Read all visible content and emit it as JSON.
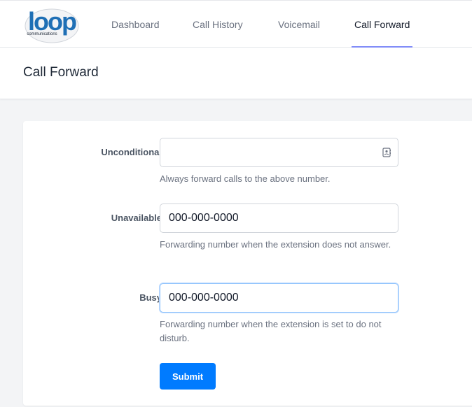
{
  "brand": {
    "logo_text": "loop",
    "logo_subtext": "communications",
    "logo_color": "#1f6fb5"
  },
  "nav": {
    "items": [
      {
        "label": "Dashboard"
      },
      {
        "label": "Call History"
      },
      {
        "label": "Voicemail"
      },
      {
        "label": "Call Forward",
        "active": true
      }
    ],
    "active_underline_color": "#818cf8"
  },
  "page": {
    "title": "Call Forward"
  },
  "form": {
    "unconditional": {
      "label": "Unconditional",
      "value": "",
      "help": "Always forward calls to the above number.",
      "icon": "contact-card-icon"
    },
    "unavailable": {
      "label": "Unavailable",
      "value": "000-000-0000",
      "help": "Forwarding number when the extension does not answer."
    },
    "busy": {
      "label": "Busy",
      "value": "000-000-0000",
      "help": "Forwarding number when the extension is set to do not disturb."
    },
    "submit_label": "Submit",
    "submit_color": "#007bff"
  }
}
